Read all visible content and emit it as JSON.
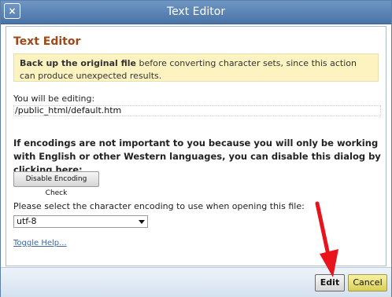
{
  "window": {
    "title": "Text Editor",
    "close_glyph": "×"
  },
  "content": {
    "heading": "Text Editor",
    "warning": {
      "bold": "Back up the original file",
      "rest": " before converting character sets, since this action can produce unexpected results."
    },
    "editing_label": "You will be editing:",
    "file_path": "/public_html/default.htm",
    "encoding_note": "If encodings are not important to you because you will only be working with English or other Western languages, you can disable this dialog by clicking here:",
    "disable_button": "Disable Encoding Check",
    "select_label": "Please select the character encoding to use when opening this file:",
    "encoding_value": "utf-8",
    "toggle_help": "Toggle Help..."
  },
  "footer": {
    "edit_label": "Edit",
    "cancel_label": "Cancel"
  },
  "colors": {
    "title_bar": "#4a74a7",
    "heading": "#a04818",
    "warning_bg": "#fdf3c0",
    "link": "#3a67a7",
    "cancel_bg": "#e6dc6a",
    "arrow": "#e8131b"
  },
  "icons": {
    "close": "close-icon",
    "dropdown": "chevron-down-icon",
    "annotation": "red-arrow-icon"
  }
}
